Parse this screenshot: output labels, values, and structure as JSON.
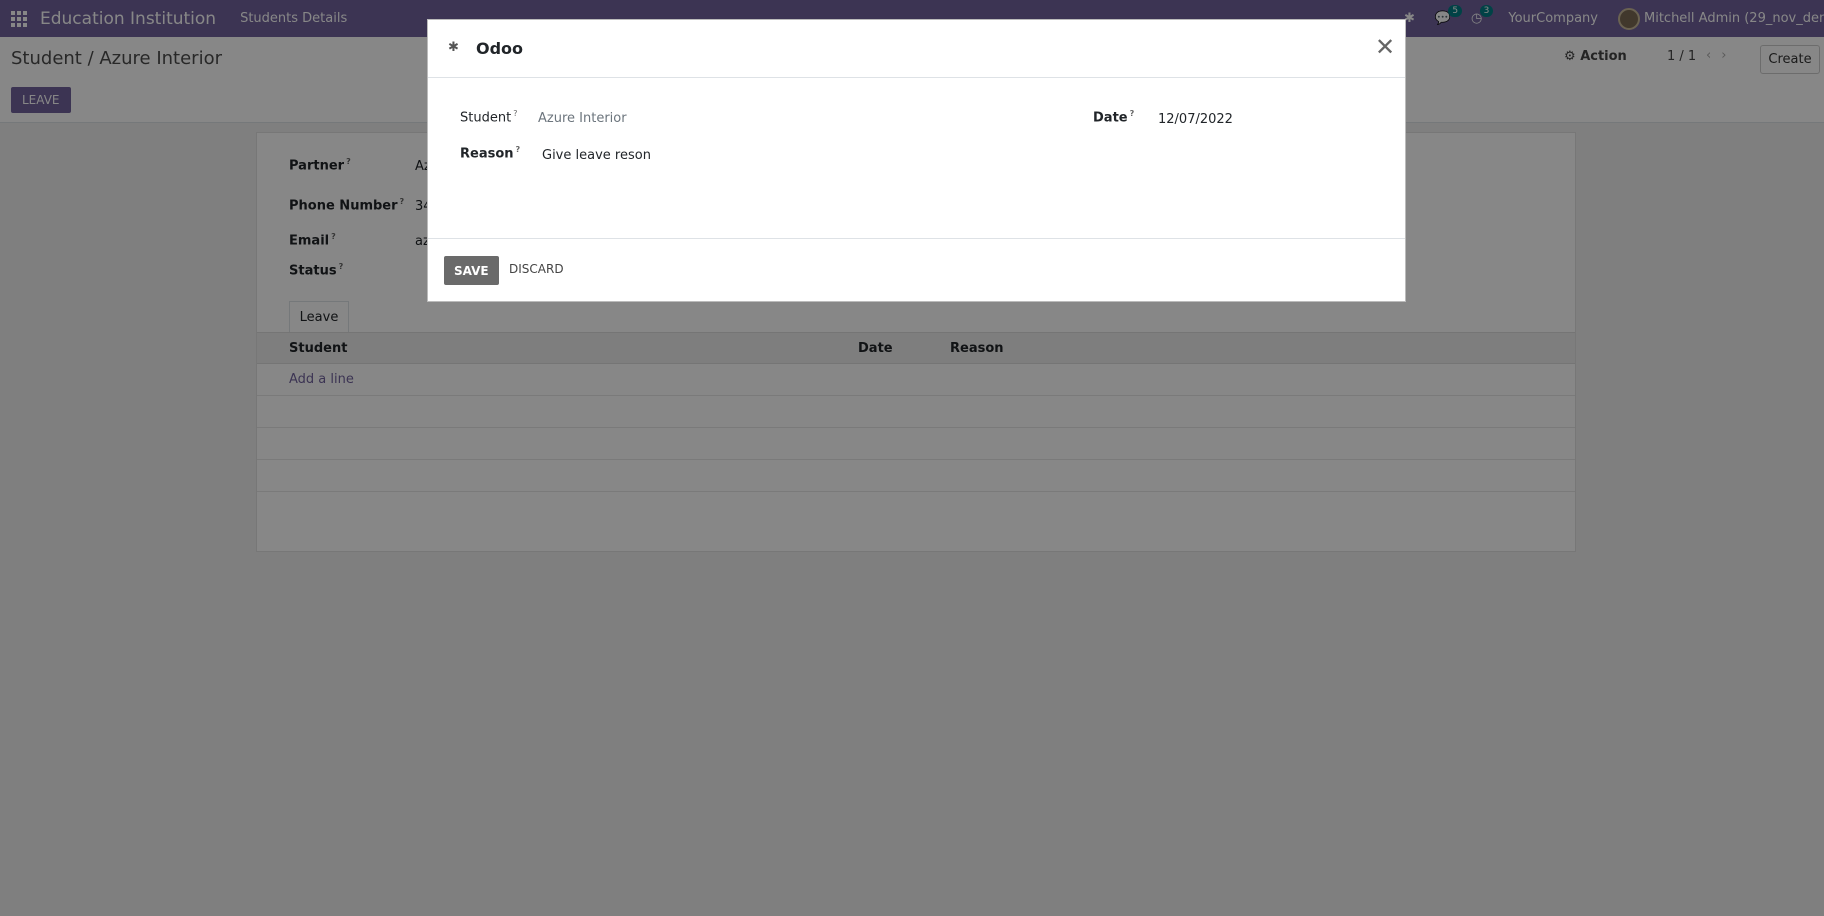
{
  "navbar": {
    "brand": "Education Institution",
    "menu_item": "Students Details",
    "messages_count": "5",
    "activities_count": "3",
    "company": "YourCompany",
    "user": "Mitchell Admin (29_nov_demo"
  },
  "control_panel": {
    "breadcrumb": "Student / Azure Interior",
    "leave_button": "LEAVE",
    "action": "Action",
    "pager": "1 / 1",
    "create": "Create"
  },
  "form": {
    "partner_label": "Partner",
    "partner_value": "Az",
    "phone_label": "Phone Number",
    "phone_value": "34",
    "email_label": "Email",
    "email_value": "az",
    "status_label": "Status",
    "tab_leave": "Leave",
    "columns": {
      "student": "Student",
      "date": "Date",
      "reason": "Reason"
    },
    "add_line": "Add a line"
  },
  "modal": {
    "title": "Odoo",
    "student_label": "Student",
    "student_value": "Azure Interior",
    "date_label": "Date",
    "date_value": "12/07/2022",
    "reason_label": "Reason",
    "reason_value": "Give leave reson",
    "save": "SAVE",
    "discard": "DISCARD"
  },
  "icons": {
    "apps": "apps-grid-icon",
    "bug": "bug-icon",
    "chat": "chat-icon",
    "clock": "clock-icon",
    "gear": "gear-icon",
    "close": "close-icon"
  }
}
